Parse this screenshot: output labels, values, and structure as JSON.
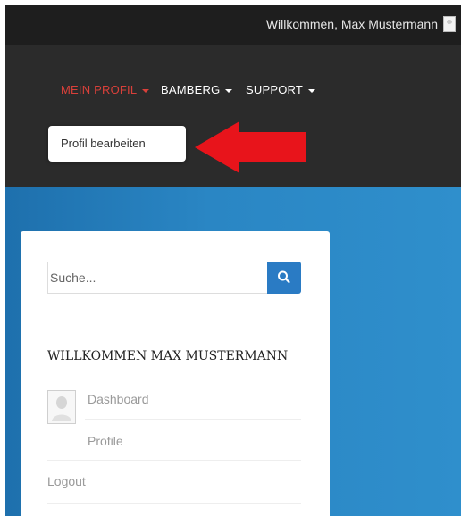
{
  "topbar": {
    "welcome_text": "Willkommen, Max Mustermann",
    "user_icon": "user-icon"
  },
  "nav": {
    "items": [
      {
        "label": "MEIN PROFIL",
        "active": true
      },
      {
        "label": "BAMBERG",
        "active": false
      },
      {
        "label": "SUPPORT",
        "active": false
      }
    ],
    "dropdown": {
      "items": [
        "Profil bearbeiten"
      ]
    }
  },
  "sidebar": {
    "search": {
      "placeholder": "Suche...",
      "icon": "search-icon"
    },
    "widget_title": "WILLKOMMEN MAX MUSTERMANN",
    "links": {
      "dashboard": "Dashboard",
      "profile": "Profile",
      "logout": "Logout"
    }
  },
  "colors": {
    "topbar_bg": "#1e1e1e",
    "navbar_bg": "#2b2b2b",
    "active_nav": "#d9403a",
    "arrow": "#e8141b",
    "content_blue": "#2a86c4",
    "search_button": "#2a7bc4"
  }
}
